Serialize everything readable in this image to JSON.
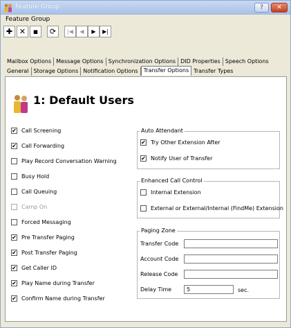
{
  "window": {
    "title": "Feature Group",
    "subtitle": "Feature Group",
    "help_label": "?",
    "close_label": "✕"
  },
  "tabs_row1": [
    "Mailbox Options",
    "Message Options",
    "Synchronization Options",
    "DID Properties",
    "Speech Options"
  ],
  "tabs_row2": [
    "General",
    "Storage Options",
    "Notification Options",
    "Transfer Options",
    "Transfer Types"
  ],
  "active_tab": "Transfer Options",
  "heading": "1: Default Users",
  "left_options": [
    {
      "label": "Call Screening",
      "checked": true,
      "enabled": true
    },
    {
      "label": "Call Forwarding",
      "checked": true,
      "enabled": true
    },
    {
      "label": "Play Record Conversation Warning",
      "checked": false,
      "enabled": true
    },
    {
      "label": "Busy Hold",
      "checked": false,
      "enabled": true
    },
    {
      "label": "Call Queuing",
      "checked": false,
      "enabled": true
    },
    {
      "label": "Camp On",
      "checked": false,
      "enabled": false
    },
    {
      "label": "Forced Messaging",
      "checked": false,
      "enabled": true
    },
    {
      "label": "Pre Transfer Paging",
      "checked": true,
      "enabled": true
    },
    {
      "label": "Post Transfer Paging",
      "checked": true,
      "enabled": true
    },
    {
      "label": "Get Caller ID",
      "checked": true,
      "enabled": true
    },
    {
      "label": "Play Name during Transfer",
      "checked": true,
      "enabled": true
    },
    {
      "label": "Confirm Name during Transfer",
      "checked": true,
      "enabled": true
    }
  ],
  "auto_attendant": {
    "title": "Auto Attendant",
    "options": [
      {
        "label": "Try Other Extension After",
        "checked": true
      },
      {
        "label": "Notify User of Transfer",
        "checked": true
      }
    ]
  },
  "enhanced_call_control": {
    "title": "Enhanced Call Control",
    "options": [
      {
        "label": "Internal Extension",
        "checked": false
      },
      {
        "label": "External or External/Internal (FindMe) Extension",
        "checked": false
      }
    ]
  },
  "paging_zone": {
    "title": "Paging Zone",
    "transfer_code_label": "Transfer Code",
    "transfer_code_value": "",
    "account_code_label": "Account Code",
    "account_code_value": "",
    "release_code_label": "Release Code",
    "release_code_value": "",
    "delay_time_label": "Delay Time",
    "delay_time_value": "5",
    "delay_unit": "sec."
  },
  "colors": {
    "title_gradient_top": "#c9d9f2",
    "close_button": "#c4411f",
    "panel_background": "#ffffff"
  }
}
